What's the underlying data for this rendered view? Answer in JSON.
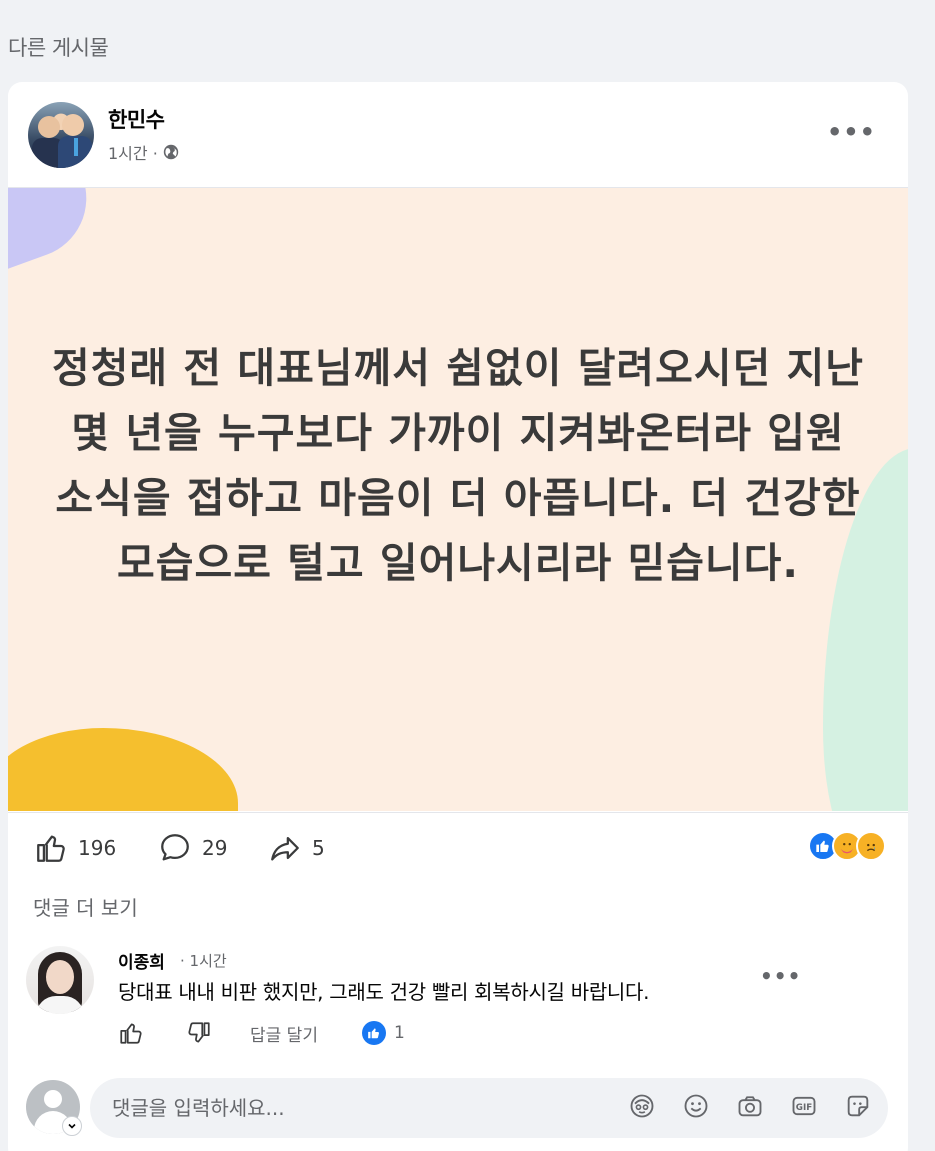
{
  "section_title": "다른 게시물",
  "post": {
    "author": "한민수",
    "time": "1시간 ·",
    "text": "정청래 전 대표님께서 쉼없이 달려오시던 지난 몇 년을 누구보다 가까이 지켜봐온터라 입원 소식을 접하고 마음이 더 아픕니다. 더 건강한 모습으로 털고 일어나시리라 믿습니다.",
    "background_color": "#fdeee2",
    "likes": "196",
    "comments": "29",
    "shares": "5",
    "reaction_icons": [
      "like-icon",
      "care-icon",
      "sad-icon"
    ]
  },
  "more_comments_label": "댓글 더 보기",
  "comment": {
    "author": "이종희",
    "time": "· 1시간",
    "text": "당대표 내내 비판 했지만, 그래도 건강 빨리 회복하시길 바랍니다.",
    "reply_label": "답글 달기",
    "like_count": "1"
  },
  "composer": {
    "placeholder": "댓글을 입력하세요...",
    "tools": [
      "avatar-sticker-icon",
      "emoji-icon",
      "camera-icon",
      "gif-icon",
      "sticker-icon"
    ]
  },
  "colors": {
    "accent": "#1877f2",
    "secondary_text": "#65676b",
    "page_bg": "#f0f2f5"
  }
}
